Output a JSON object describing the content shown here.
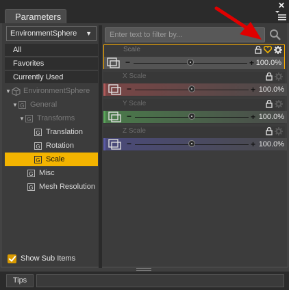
{
  "window": {
    "tab_title": "Parameters",
    "close_glyph": "✕"
  },
  "left": {
    "node_dropdown": "EnvironmentSphere",
    "nav": [
      "All",
      "Favorites",
      "Currently Used"
    ],
    "tree": {
      "root": "EnvironmentSphere",
      "general": "General",
      "transforms": "Transforms",
      "translation": "Translation",
      "rotation": "Rotation",
      "scale": "Scale",
      "misc": "Misc",
      "mesh_resolution": "Mesh Resolution"
    },
    "show_sub_items": {
      "label": "Show Sub Items",
      "checked": true
    }
  },
  "right": {
    "filter_placeholder": "Enter text to filter by...",
    "params": [
      {
        "label": "Scale",
        "value": "100.0%",
        "color": "#ffb000",
        "fill": "#3c3c3c",
        "selected": true,
        "slider_position": 0.5
      },
      {
        "label": "X Scale",
        "value": "100.0%",
        "color": "#b05a5a",
        "fill": "#7a4545",
        "selected": false,
        "slider_position": 0.5
      },
      {
        "label": "Y Scale",
        "value": "100.0%",
        "color": "#5aa55a",
        "fill": "#4a7a4a",
        "selected": false,
        "slider_position": 0.5
      },
      {
        "label": "Z Scale",
        "value": "100.0%",
        "color": "#5a5aa5",
        "fill": "#4a4a7a",
        "selected": false,
        "slider_position": 0.5
      }
    ],
    "minus_glyph": "−",
    "plus_glyph": "+"
  },
  "bottom": {
    "tips_label": "Tips"
  },
  "colors": {
    "accent": "#f3b400",
    "annotation": "#e00000"
  },
  "icons": [
    "close-icon",
    "panel-menu-icon",
    "search-icon",
    "lock-icon",
    "favorite-heart-icon",
    "gear-icon",
    "keyframe-icon",
    "red-arrow-annotation"
  ]
}
